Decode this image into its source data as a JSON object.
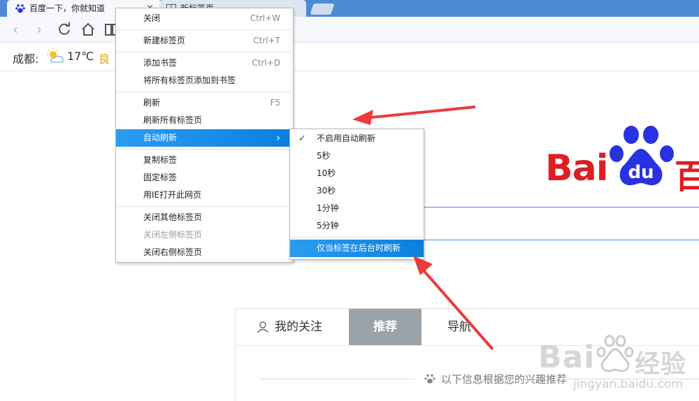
{
  "browser": {
    "active_tab_title": "百度一下，你就知道",
    "active_tab_close": "×",
    "inactive_tab_title": "新标签页"
  },
  "weather": {
    "city": "成都:",
    "temperature": "17℃",
    "air_quality": "良"
  },
  "logo": {
    "text": "Bai",
    "du": "du",
    "cn": "百"
  },
  "feed": {
    "tabs": [
      "我的关注",
      "推荐",
      "导航"
    ],
    "hint": "以下信息根据您的兴趣推荐"
  },
  "context_menu": {
    "items": [
      {
        "label": "关闭",
        "shortcut": "Ctrl+W"
      },
      {
        "label": "新建标签页",
        "shortcut": "Ctrl+T"
      },
      {
        "label": "添加书签",
        "shortcut": "Ctrl+D"
      },
      {
        "label": "将所有标签页添加到书签",
        "shortcut": ""
      },
      {
        "label": "刷新",
        "shortcut": "F5"
      },
      {
        "label": "刷新所有标签页",
        "shortcut": ""
      },
      {
        "label": "自动刷新",
        "shortcut": "›"
      },
      {
        "label": "复制标签",
        "shortcut": ""
      },
      {
        "label": "固定标签",
        "shortcut": ""
      },
      {
        "label": "用IE打开此网页",
        "shortcut": ""
      },
      {
        "label": "关闭其他标签页",
        "shortcut": ""
      },
      {
        "label": "关闭左侧标签页",
        "shortcut": ""
      },
      {
        "label": "关闭右侧标签页",
        "shortcut": ""
      }
    ]
  },
  "auto_refresh_submenu": {
    "items": [
      {
        "label": "不启用自动刷新",
        "checked": true
      },
      {
        "label": "5秒"
      },
      {
        "label": "10秒"
      },
      {
        "label": "30秒"
      },
      {
        "label": "1分钟"
      },
      {
        "label": "5分钟"
      },
      {
        "label": "仅当标签在后台时刷新"
      }
    ],
    "check_mark": "✓"
  },
  "watermark": {
    "brand": "Bai",
    "brand_suffix": "经验",
    "url": "jingyan.baidu.com"
  },
  "colors": {
    "tabbar": "#4f8ad6",
    "highlight": "#0a7fde",
    "baidu_red": "#de1d24",
    "baidu_blue": "#2932e1",
    "annotation_arrow": "#ec3b3b"
  }
}
